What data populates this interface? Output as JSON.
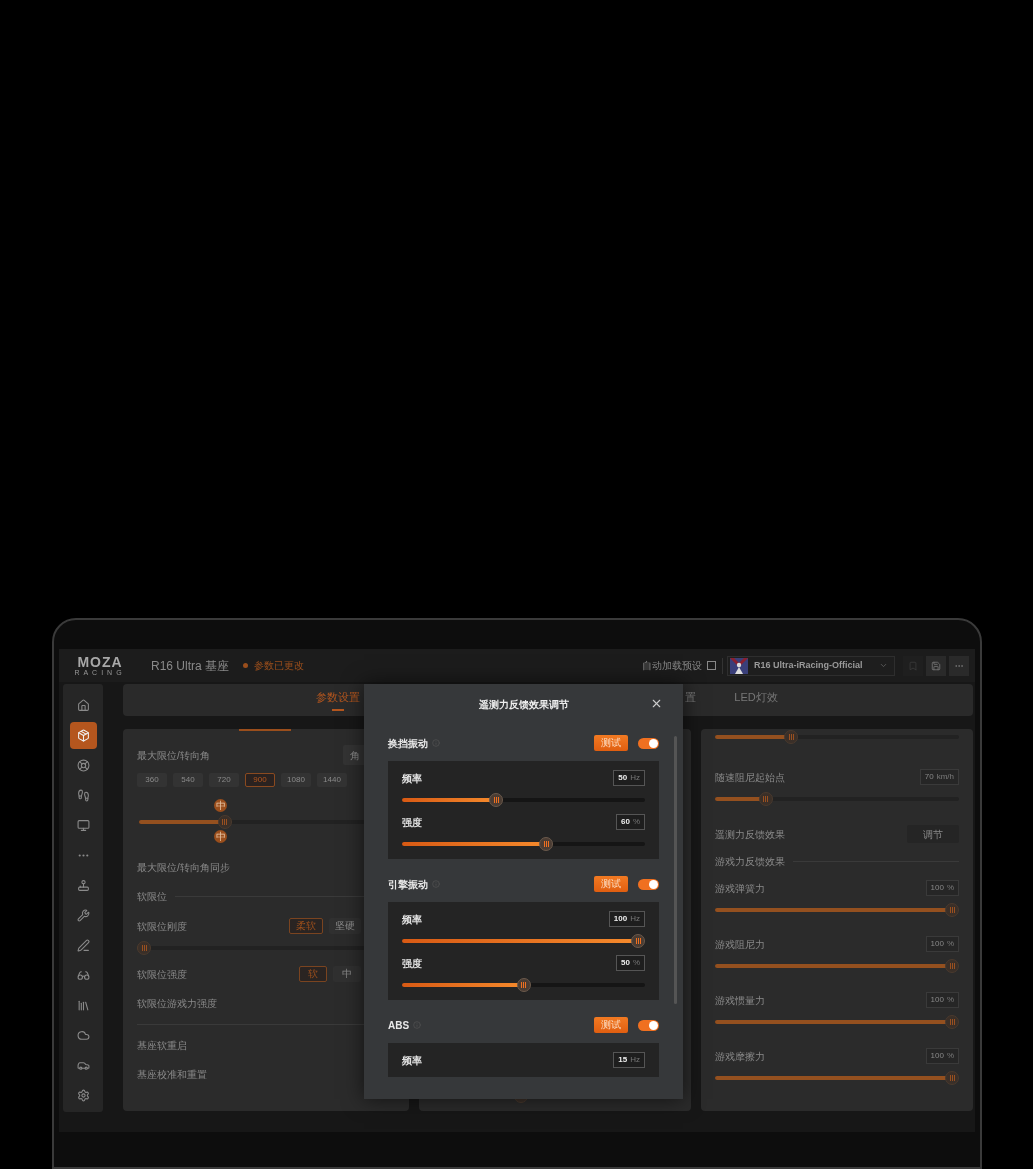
{
  "header": {
    "logo": "MOZA",
    "logo_sub": "RACING",
    "device": "R16 Ultra 基座",
    "status": "参数已更改",
    "auto_load": {
      "label": "自动加载预设",
      "checked": false
    },
    "preset": "R16 Ultra-iRacing-Official"
  },
  "sidebar": [
    {
      "selected": false
    },
    {
      "selected": true
    },
    {
      "selected": false
    },
    {
      "selected": false
    },
    {
      "selected": false
    },
    {
      "selected": false
    },
    {
      "selected": false
    },
    {
      "selected": false
    },
    {
      "selected": false
    },
    {
      "selected": false
    },
    {
      "selected": false
    },
    {
      "selected": false
    },
    {
      "selected": false
    },
    {
      "selected": false
    }
  ],
  "tabs": [
    {
      "label": "参数设置",
      "selected": true
    },
    {
      "label": "置",
      "selected": false
    },
    {
      "label": "LED灯效",
      "selected": false
    }
  ],
  "left_panel": {
    "max_angle": {
      "label": "最大限位/转向角",
      "button": "角",
      "presets": [
        {
          "label": "360",
          "selected": false
        },
        {
          "label": "540",
          "selected": false
        },
        {
          "label": "720",
          "selected": false
        },
        {
          "label": "900",
          "selected": true
        },
        {
          "label": "1080",
          "selected": false
        },
        {
          "label": "1440",
          "selected": false
        }
      ],
      "range": {
        "level": 0.3,
        "marker_top": "中",
        "marker_bottom": "中"
      }
    },
    "rows": [
      {
        "kind": "plain",
        "label": "最大限位/转向角同步"
      },
      {
        "kind": "heading",
        "label": "软限位"
      },
      {
        "kind": "options",
        "label": "软限位刚度",
        "options": [
          {
            "label": "柔软",
            "selected": true
          },
          {
            "label": "坚硬",
            "selected": false
          }
        ],
        "level": 0
      },
      {
        "kind": "options",
        "label": "软限位强度",
        "options": [
          {
            "label": "软",
            "selected": true
          },
          {
            "label": "中",
            "selected": false
          }
        ]
      },
      {
        "kind": "plain",
        "label": "软限位游戏力强度"
      },
      {
        "kind": "divider"
      },
      {
        "kind": "plain",
        "label": "基座软重启"
      },
      {
        "kind": "plain",
        "label": "基座校准和重置"
      }
    ]
  },
  "middle_panel": {
    "slider": {
      "level": 0.35
    }
  },
  "right_panel": {
    "rows": [
      {
        "kind": "slider",
        "level": 0.3
      },
      {
        "kind": "value_slider",
        "label": "随速阻尼起始点",
        "value": "70",
        "unit": "km/h",
        "level": 0.19
      },
      {
        "kind": "button",
        "label": "遥测力反馈效果",
        "button": "调节"
      },
      {
        "kind": "heading",
        "label": "游戏力反馈效果"
      },
      {
        "kind": "value_slider",
        "label": "游戏弹簧力",
        "value": "100",
        "unit": "%",
        "level": 1
      },
      {
        "kind": "value_slider",
        "label": "游戏阻尼力",
        "value": "100",
        "unit": "%",
        "level": 1
      },
      {
        "kind": "value_slider",
        "label": "游戏惯量力",
        "value": "100",
        "unit": "%",
        "level": 1
      },
      {
        "kind": "value_slider",
        "label": "游戏摩擦力",
        "value": "100",
        "unit": "%",
        "level": 1
      }
    ]
  },
  "dialog": {
    "title": "遥测力反馈效果调节",
    "sections": [
      {
        "title": "换挡振动",
        "test_button": "测试",
        "on": true,
        "params": [
          {
            "label": "频率",
            "value": "50",
            "unit": "Hz",
            "level": 0.38
          },
          {
            "label": "强度",
            "value": "60",
            "unit": "%",
            "level": 0.6
          }
        ]
      },
      {
        "title": "引擎振动",
        "test_button": "测试",
        "on": true,
        "params": [
          {
            "label": "频率",
            "value": "100",
            "unit": "Hz",
            "level": 1
          },
          {
            "label": "强度",
            "value": "50",
            "unit": "%",
            "level": 0.5
          }
        ]
      },
      {
        "title": "ABS",
        "test_button": "测试",
        "on": true,
        "params": [
          {
            "label": "频率",
            "value": "15",
            "unit": "Hz"
          }
        ]
      }
    ]
  }
}
